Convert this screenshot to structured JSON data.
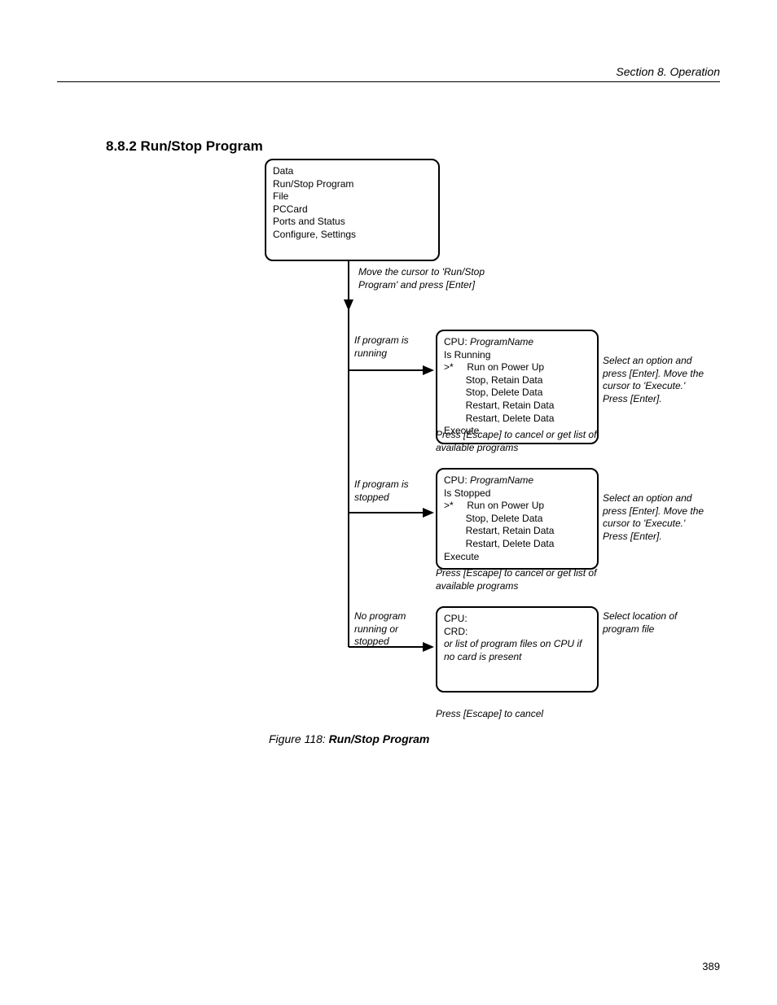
{
  "header": {
    "section_label": "Section 8.  Operation"
  },
  "section_title": "8.8.2 Run/Stop Program",
  "menu_box": {
    "items": [
      "Data",
      "Run/Stop Program",
      "File",
      "PCCard",
      "Ports and Status",
      "Configure, Settings"
    ]
  },
  "label_move": "Move the cursor to 'Run/Stop Program' and press [Enter]",
  "branch_running": {
    "condition": "If program is running",
    "lines": {
      "l0": "CPU:",
      "l0_i": "ProgramName",
      "l1": "Is Running",
      "l2": ">*     Run on Power Up",
      "l3": "        Stop, Retain Data",
      "l4": "        Stop, Delete Data",
      "l5": "        Restart, Retain Data",
      "l6": "        Restart, Delete Data",
      "l7": "Execute"
    },
    "note": "Select an option and press [Enter]. Move the cursor to 'Execute.' Press [Enter].",
    "escape": "Press [Escape] to cancel or get list of available programs"
  },
  "branch_stopped": {
    "condition": "If program is stopped",
    "lines": {
      "l0": "CPU:",
      "l0_i": "ProgramName",
      "l1": "Is Stopped",
      "l2": ">*     Run on Power Up",
      "l3": "        Stop, Delete Data",
      "l4": "        Restart, Retain Data",
      "l5": "        Restart, Delete Data",
      "l6": "Execute"
    },
    "note": "Select an option and press [Enter]. Move the cursor to 'Execute.' Press [Enter].",
    "escape": "Press [Escape] to cancel or get list of available programs"
  },
  "branch_noprog": {
    "condition": "No program running or stopped",
    "lines": {
      "l0": "CPU:",
      "l1": "CRD:",
      "l2_i": "or list of program files on CPU if no card is present"
    },
    "note": "Select location of program file",
    "escape": "Press [Escape] to cancel"
  },
  "figure": {
    "prefix": "Figure 118: ",
    "title": "Run/Stop Program"
  },
  "page_number": "389"
}
